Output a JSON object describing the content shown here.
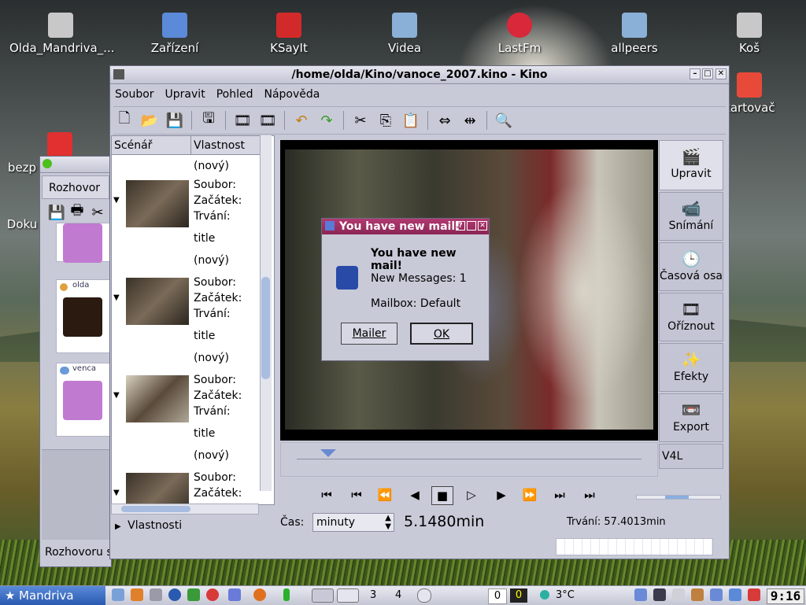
{
  "desktop": {
    "icons": [
      {
        "label": "Olda_Mandriva_...",
        "icon": "computer-icon",
        "color": "#d0d0d0"
      },
      {
        "label": "Zařízení",
        "icon": "monitor-icon",
        "color": "#5a8ad8"
      },
      {
        "label": "KSayIt",
        "icon": "ksayit-icon",
        "color": "#d22a2a"
      },
      {
        "label": "Videa",
        "icon": "folder-video-icon",
        "color": "#8ab0d8"
      },
      {
        "label": "LastFm",
        "icon": "lastfm-icon",
        "color": "#d8283a"
      },
      {
        "label": "allpeers",
        "icon": "allpeers-icon",
        "color": "#8ab0d8"
      },
      {
        "label": "Koš",
        "icon": "trash-icon",
        "color": "#c8c8c8"
      },
      {
        "label": "kartovač",
        "icon": "eraser-icon",
        "color": "#e84a3a"
      },
      {
        "label": "bezp",
        "icon": "pdf-icon",
        "color": "#e03030"
      },
      {
        "label": "Doku",
        "icon": "document-icon",
        "color": "#d0d0d0"
      }
    ]
  },
  "kino": {
    "title": "/home/olda/Kino/vanoce_2007.kino - Kino",
    "menu": [
      "Soubor",
      "Upravit",
      "Pohled",
      "Nápověda"
    ],
    "toolbar": [
      "new-icon",
      "open-icon",
      "save-icon",
      "|",
      "save-frame-icon",
      "|",
      "film-icon",
      "film-icon",
      "|",
      "undo-icon",
      "redo-icon",
      "|",
      "cut-icon",
      "copy-icon",
      "paste-icon",
      "|",
      "expand-icon",
      "contract-icon",
      "|",
      "zoom-icon"
    ],
    "story": {
      "col1": "Scénář",
      "col2": "Vlastnost",
      "new_label": "(nový)",
      "file_label": "Soubor:",
      "start_label": "Začátek:",
      "duration_label": "Trvání:",
      "title_label": "title",
      "properties": "Vlastnosti"
    },
    "tabs": [
      {
        "label": "Upravit",
        "icon": "edit-icon"
      },
      {
        "label": "Snímání",
        "icon": "camera-icon"
      },
      {
        "label": "Časová osa",
        "icon": "clock-icon"
      },
      {
        "label": "Oříznout",
        "icon": "trim-icon"
      },
      {
        "label": "Efekty",
        "icon": "sparkle-icon"
      },
      {
        "label": "Export",
        "icon": "export-icon"
      },
      {
        "label": "V4L",
        "icon": ""
      }
    ],
    "time_label": "Čas:",
    "time_unit": "minuty",
    "time_value": "5.1480min",
    "duration_text": "Trvání: 57.4013min",
    "progress_fraction": 0.09
  },
  "mail": {
    "title": "You have new mail!",
    "heading": "You have new mail!",
    "messages": "New Messages: 1",
    "mailbox": "Mailbox: Default",
    "mailer_button": "Mailer",
    "ok_button": "OK"
  },
  "chat": {
    "tab": "Rozhovor",
    "status": "Rozhovoru s",
    "contacts": [
      {
        "name": "olda"
      },
      {
        "name": "venca"
      }
    ]
  },
  "taskbar": {
    "start": "Mandriva",
    "desk3": "3",
    "desk4": "4",
    "counter0a": "0",
    "counter0b": "0",
    "temp": "3°C",
    "clock": "9:16"
  }
}
